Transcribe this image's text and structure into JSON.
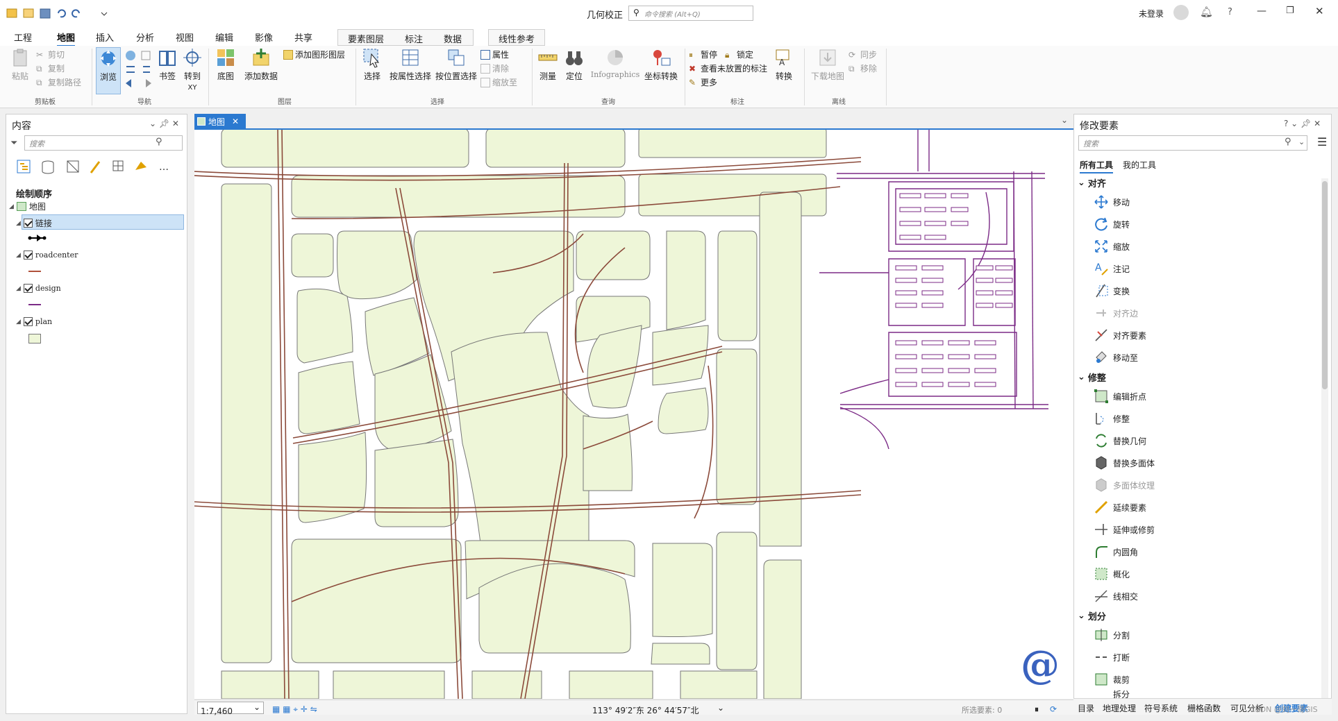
{
  "app": {
    "title": "几何校正",
    "search_placeholder": "命令搜索 (Alt+Q)",
    "user": "未登录"
  },
  "ribbon": {
    "tabs": [
      "工程",
      "地图",
      "插入",
      "分析",
      "视图",
      "编辑",
      "影像",
      "共享"
    ],
    "active_tab": "地图",
    "context_tabs": [
      "要素图层",
      "标注",
      "数据"
    ],
    "context_tab2": "线性参考",
    "groups": {
      "clipboard": {
        "label": "剪贴板",
        "paste": "粘贴",
        "cut": "剪切",
        "copy": "复制",
        "copy_path": "复制路径"
      },
      "navigate": {
        "label": "导航",
        "explore": "浏览",
        "bookmarks": "书签",
        "goto_xy_1": "转到",
        "goto_xy_2": "XY"
      },
      "layer": {
        "label": "图层",
        "basemap": "底图",
        "add_data": "添加数据",
        "add_graphics": "添加图形图层"
      },
      "selection": {
        "label": "选择",
        "select": "选择",
        "by_attr": "按属性选择",
        "by_loc": "按位置选择",
        "attributes": "属性",
        "clear": "清除",
        "zoom_to": "缩放至"
      },
      "inquiry": {
        "label": "查询",
        "measure": "测量",
        "locate": "定位",
        "infographics": "Infographics",
        "coord_convert": "坐标转换"
      },
      "labeling": {
        "label": "标注",
        "pause": "暂停",
        "lock": "锁定",
        "view_unplaced": "查看未放置的标注",
        "more": "更多",
        "convert": "转换"
      },
      "offline": {
        "label": "离线",
        "download": "下载地图",
        "sync": "同步",
        "remove": "移除"
      }
    }
  },
  "contents": {
    "title": "内容",
    "search_placeholder": "搜索",
    "drawing_order": "绘制顺序",
    "layers": [
      {
        "name": "地图",
        "checked": true
      },
      {
        "name": "链接",
        "checked": true
      },
      {
        "name": "roadcenter",
        "checked": true
      },
      {
        "name": "design",
        "checked": true
      },
      {
        "name": "plan",
        "checked": true
      }
    ]
  },
  "map_tab": {
    "label": "地图"
  },
  "colors": {
    "parcel": "#eef6d8",
    "road": "#8b4a3a",
    "design": "#7b2a86",
    "accent": "#2b79d0"
  },
  "status": {
    "scale": "1:7,460",
    "coords": "113° 49′2″东 26° 44′57″北",
    "selected": "所选要素: 0"
  },
  "modify": {
    "title": "修改要素",
    "search_placeholder": "搜索",
    "tab_all": "所有工具",
    "tab_mine": "我的工具",
    "sections": [
      {
        "name": "对齐",
        "tools": [
          "移动",
          "旋转",
          "缩放",
          "注记",
          "变换",
          "对齐边",
          "对齐要素",
          "移动至"
        ]
      },
      {
        "name": "修整",
        "tools": [
          "编辑折点",
          "修整",
          "替换几何",
          "替换多面体",
          "多面体纹理",
          "延续要素",
          "延伸或修剪",
          "内圆角",
          "概化",
          "线相交"
        ]
      },
      {
        "name": "划分",
        "tools": [
          "分割",
          "打断",
          "裁剪",
          "拆分"
        ]
      }
    ],
    "bottom_tabs": [
      "目录",
      "地理处理",
      "符号系统",
      "栅格函数",
      "可见分析",
      "创建要素"
    ]
  },
  "watermark": "@ 刘一哥GIS",
  "watermark_small": "CSDN @刘一哥GIS"
}
